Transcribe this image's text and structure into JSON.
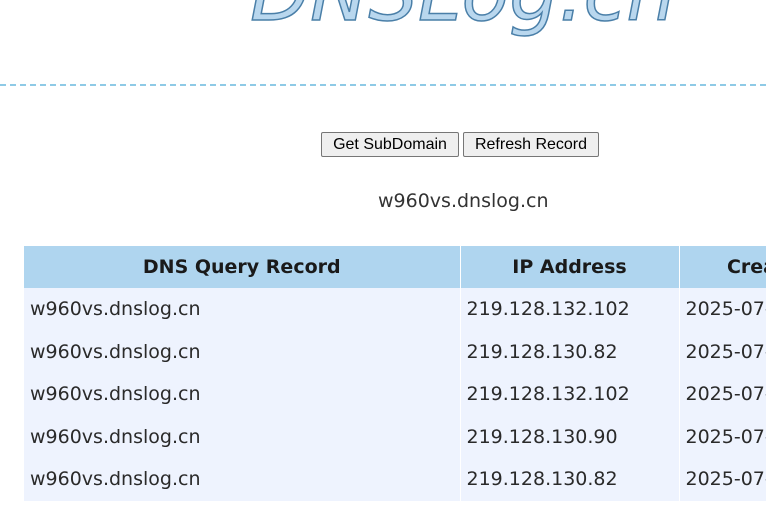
{
  "logo": {
    "text": "DNSLog.cn"
  },
  "buttons": {
    "get_subdomain": "Get SubDomain",
    "refresh_record": "Refresh Record"
  },
  "subdomain": "w960vs.dnslog.cn",
  "table": {
    "headers": [
      "DNS Query Record",
      "IP Address",
      "Crea"
    ],
    "rows": [
      [
        "w960vs.dnslog.cn",
        "219.128.132.102",
        "2025-07-"
      ],
      [
        "w960vs.dnslog.cn",
        "219.128.130.82",
        "2025-07-"
      ],
      [
        "w960vs.dnslog.cn",
        "219.128.132.102",
        "2025-07-"
      ],
      [
        "w960vs.dnslog.cn",
        "219.128.130.90",
        "2025-07-"
      ],
      [
        "w960vs.dnslog.cn",
        "219.128.130.82",
        "2025-07-"
      ]
    ]
  },
  "colors": {
    "header_bg": "#afd5ef",
    "row_bg": "#eef3fe",
    "divider": "#8ecae6",
    "logo_fill": "#b9d7ee",
    "logo_stroke": "#4a7fa8"
  }
}
